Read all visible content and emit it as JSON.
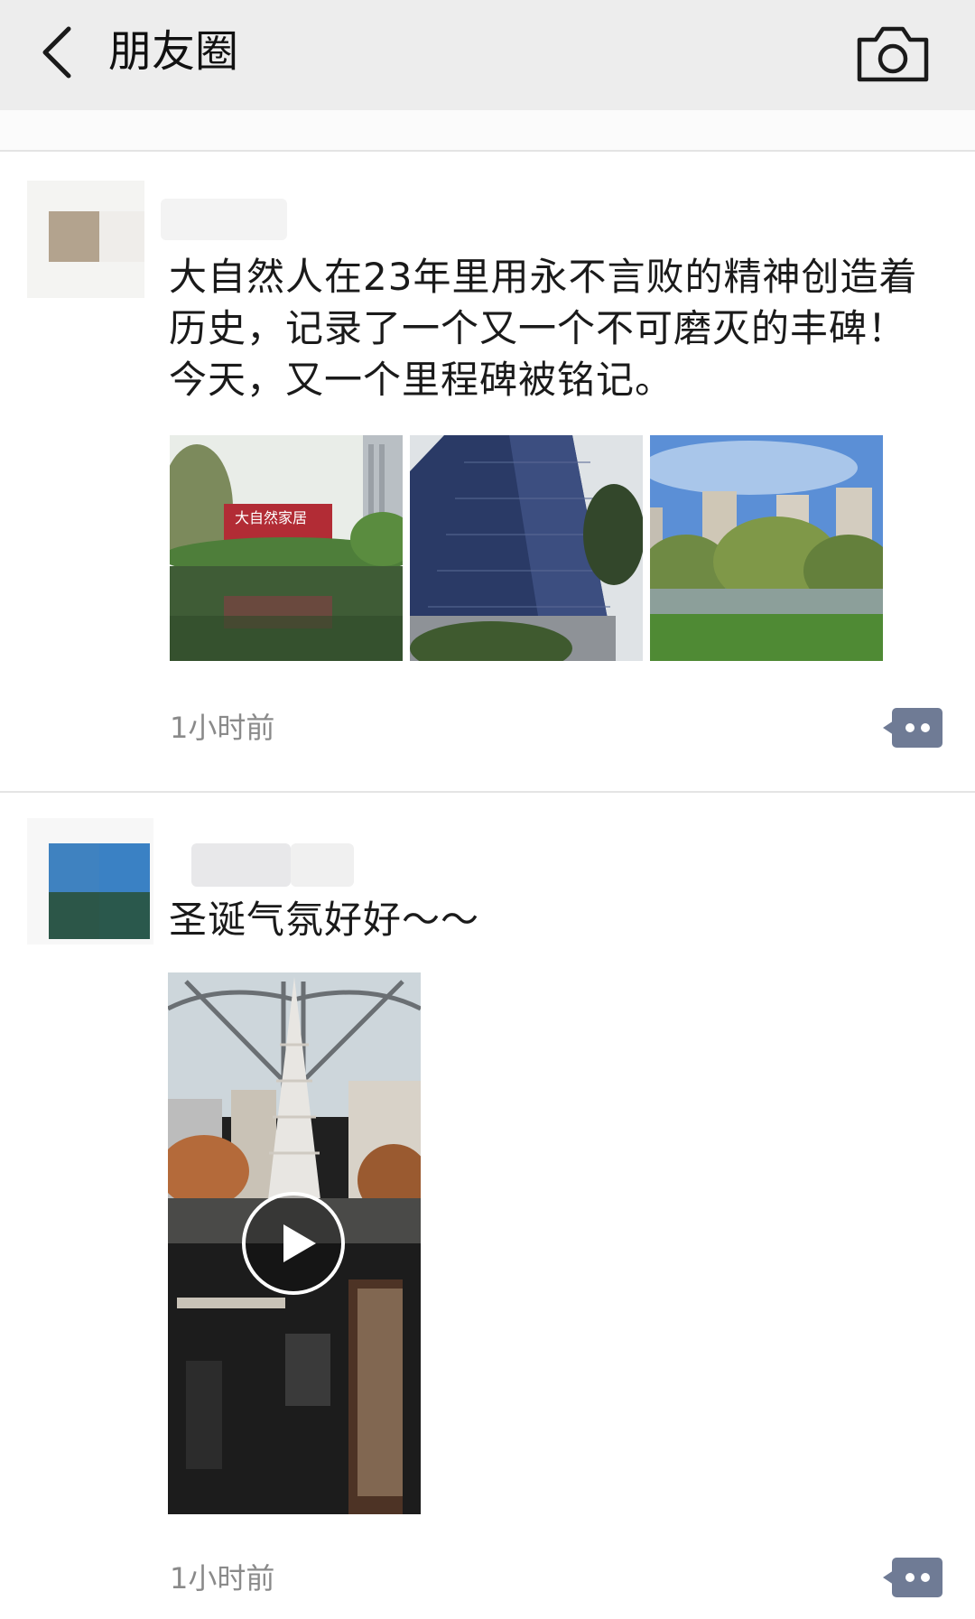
{
  "header": {
    "title": "朋友圈",
    "back_icon": "chevron-left-icon",
    "camera_icon": "camera-icon"
  },
  "posts": [
    {
      "text": "大自然人在23年里用永不言败的精神创造着历史，记录了一个又一个不可磨灭的丰碑！今天，又一个里程碑被铭记。",
      "photos": [
        {
          "sign_text": "大自然家居"
        }
      ],
      "time": "1小时前",
      "more_icon": "comment-dots-icon"
    },
    {
      "text": "圣诞气氛好好～～",
      "video": {
        "play_icon": "play-icon"
      },
      "time": "1小时前",
      "more_icon": "comment-dots-icon"
    }
  ],
  "colors": {
    "header_bg": "#ededed",
    "divider": "#e4e4e4",
    "time_text": "#8a8a8a",
    "action_btn": "#6f7b95"
  }
}
